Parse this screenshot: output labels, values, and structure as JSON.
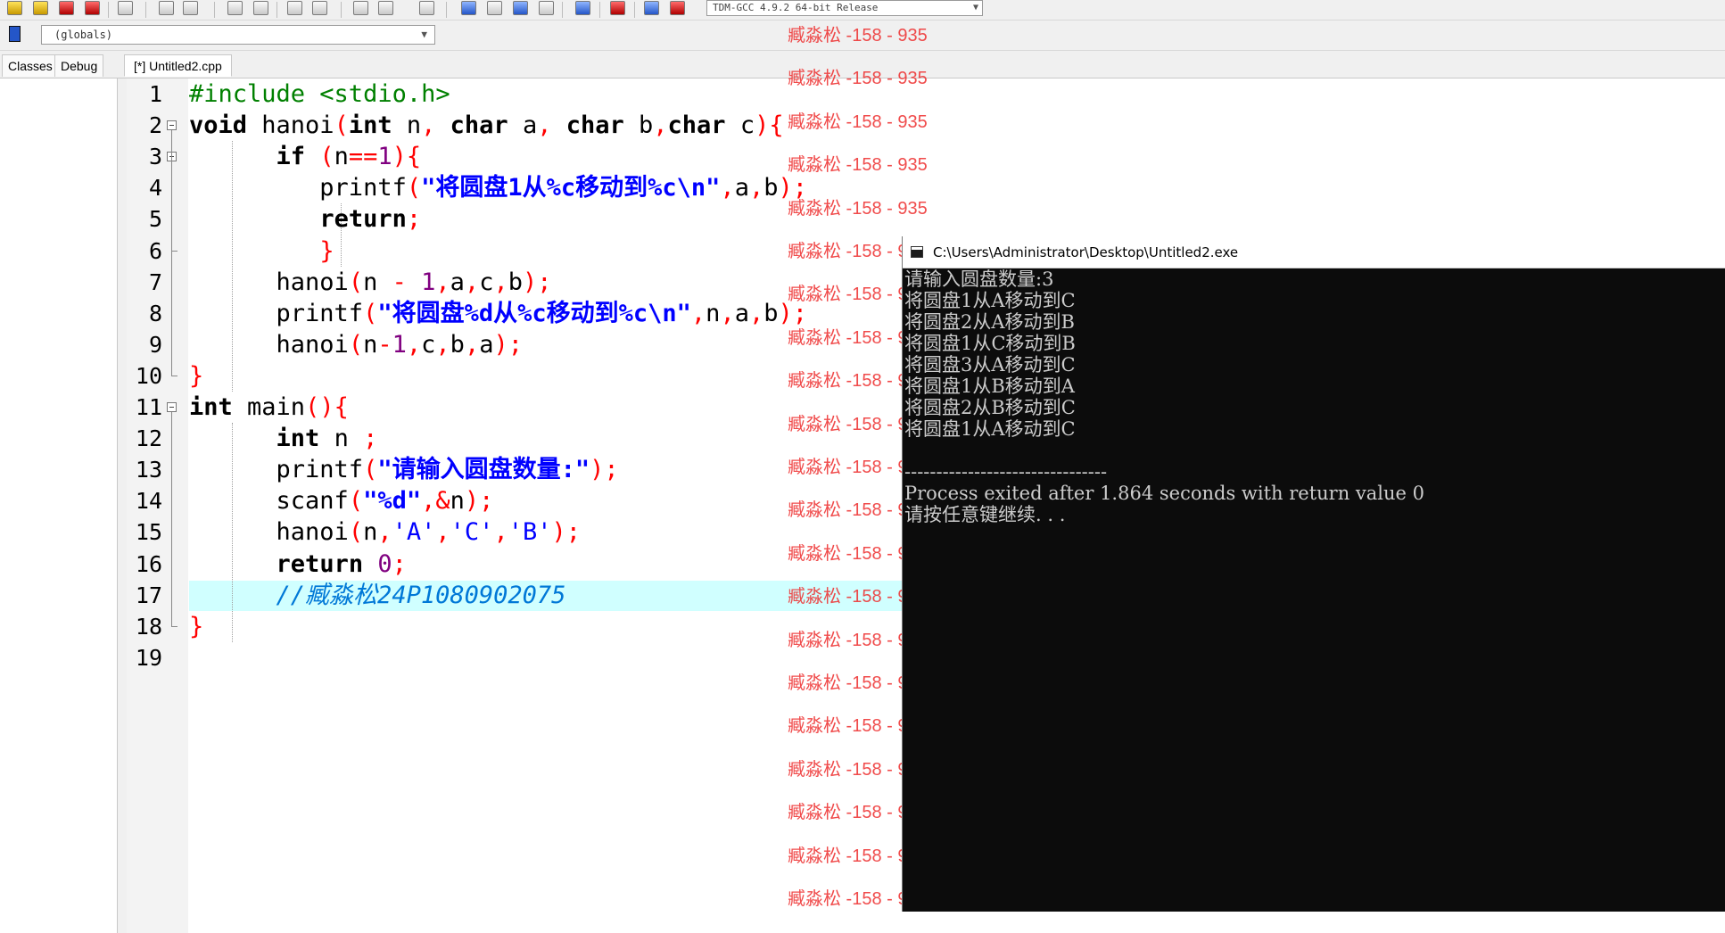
{
  "toolbar": {
    "compiler_profile": "TDM-GCC 4.9.2 64-bit Release",
    "scope": "(globals)"
  },
  "tabs": {
    "left": [
      "Classes",
      "Debug"
    ],
    "file": "[*] Untitled2.cpp"
  },
  "editor": {
    "line_numbers": [
      "1",
      "2",
      "3",
      "4",
      "5",
      "6",
      "7",
      "8",
      "9",
      "10",
      "11",
      "12",
      "13",
      "14",
      "15",
      "16",
      "17",
      "18",
      "19"
    ],
    "lines": [
      [
        {
          "c": "pp",
          "t": "#include <stdio.h>"
        }
      ],
      [
        {
          "c": "kw",
          "t": "void"
        },
        {
          "c": "",
          "t": " hanoi"
        },
        {
          "c": "sym",
          "t": "("
        },
        {
          "c": "kw",
          "t": "int"
        },
        {
          "c": "",
          "t": " n"
        },
        {
          "c": "sym",
          "t": ", "
        },
        {
          "c": "kw",
          "t": "char"
        },
        {
          "c": "",
          "t": " a"
        },
        {
          "c": "sym",
          "t": ", "
        },
        {
          "c": "kw",
          "t": "char"
        },
        {
          "c": "",
          "t": " b"
        },
        {
          "c": "sym",
          "t": ","
        },
        {
          "c": "kw",
          "t": "char"
        },
        {
          "c": "",
          "t": " c"
        },
        {
          "c": "sym",
          "t": "){"
        }
      ],
      [
        {
          "c": "",
          "t": "      "
        },
        {
          "c": "kw",
          "t": "if"
        },
        {
          "c": "",
          "t": " "
        },
        {
          "c": "sym",
          "t": "("
        },
        {
          "c": "",
          "t": "n"
        },
        {
          "c": "sym",
          "t": "=="
        },
        {
          "c": "num",
          "t": "1"
        },
        {
          "c": "sym",
          "t": "){"
        }
      ],
      [
        {
          "c": "",
          "t": "         printf"
        },
        {
          "c": "sym",
          "t": "("
        },
        {
          "c": "str",
          "t": "\"将圆盘1从%c移动到%c\\n\""
        },
        {
          "c": "sym",
          "t": ","
        },
        {
          "c": "",
          "t": "a"
        },
        {
          "c": "sym",
          "t": ","
        },
        {
          "c": "",
          "t": "b"
        },
        {
          "c": "sym",
          "t": ");"
        }
      ],
      [
        {
          "c": "",
          "t": "         "
        },
        {
          "c": "kw",
          "t": "return"
        },
        {
          "c": "sym",
          "t": ";"
        }
      ],
      [
        {
          "c": "",
          "t": "         "
        },
        {
          "c": "sym",
          "t": "}"
        }
      ],
      [
        {
          "c": "",
          "t": "      hanoi"
        },
        {
          "c": "sym",
          "t": "("
        },
        {
          "c": "",
          "t": "n "
        },
        {
          "c": "sym",
          "t": "-"
        },
        {
          "c": "",
          "t": " "
        },
        {
          "c": "num",
          "t": "1"
        },
        {
          "c": "sym",
          "t": ","
        },
        {
          "c": "",
          "t": "a"
        },
        {
          "c": "sym",
          "t": ","
        },
        {
          "c": "",
          "t": "c"
        },
        {
          "c": "sym",
          "t": ","
        },
        {
          "c": "",
          "t": "b"
        },
        {
          "c": "sym",
          "t": ");"
        }
      ],
      [
        {
          "c": "",
          "t": "      printf"
        },
        {
          "c": "sym",
          "t": "("
        },
        {
          "c": "str",
          "t": "\"将圆盘%d从%c移动到%c\\n\""
        },
        {
          "c": "sym",
          "t": ","
        },
        {
          "c": "",
          "t": "n"
        },
        {
          "c": "sym",
          "t": ","
        },
        {
          "c": "",
          "t": "a"
        },
        {
          "c": "sym",
          "t": ","
        },
        {
          "c": "",
          "t": "b"
        },
        {
          "c": "sym",
          "t": ");"
        }
      ],
      [
        {
          "c": "",
          "t": "      hanoi"
        },
        {
          "c": "sym",
          "t": "("
        },
        {
          "c": "",
          "t": "n"
        },
        {
          "c": "sym",
          "t": "-"
        },
        {
          "c": "num",
          "t": "1"
        },
        {
          "c": "sym",
          "t": ","
        },
        {
          "c": "",
          "t": "c"
        },
        {
          "c": "sym",
          "t": ","
        },
        {
          "c": "",
          "t": "b"
        },
        {
          "c": "sym",
          "t": ","
        },
        {
          "c": "",
          "t": "a"
        },
        {
          "c": "sym",
          "t": ");"
        }
      ],
      [
        {
          "c": "sym",
          "t": "}"
        }
      ],
      [
        {
          "c": "kw",
          "t": "int"
        },
        {
          "c": "",
          "t": " main"
        },
        {
          "c": "sym",
          "t": "(){"
        }
      ],
      [
        {
          "c": "",
          "t": "      "
        },
        {
          "c": "kw",
          "t": "int"
        },
        {
          "c": "",
          "t": " n "
        },
        {
          "c": "sym",
          "t": ";"
        }
      ],
      [
        {
          "c": "",
          "t": "      printf"
        },
        {
          "c": "sym",
          "t": "("
        },
        {
          "c": "str",
          "t": "\"请输入圆盘数量:\""
        },
        {
          "c": "sym",
          "t": ");"
        }
      ],
      [
        {
          "c": "",
          "t": "      scanf"
        },
        {
          "c": "sym",
          "t": "("
        },
        {
          "c": "str",
          "t": "\"%d\""
        },
        {
          "c": "sym",
          "t": ",&"
        },
        {
          "c": "",
          "t": "n"
        },
        {
          "c": "sym",
          "t": ");"
        }
      ],
      [
        {
          "c": "",
          "t": "      hanoi"
        },
        {
          "c": "sym",
          "t": "("
        },
        {
          "c": "",
          "t": "n"
        },
        {
          "c": "sym",
          "t": ","
        },
        {
          "c": "chr",
          "t": "'A'"
        },
        {
          "c": "sym",
          "t": ","
        },
        {
          "c": "chr",
          "t": "'C'"
        },
        {
          "c": "sym",
          "t": ","
        },
        {
          "c": "chr",
          "t": "'B'"
        },
        {
          "c": "sym",
          "t": ");"
        }
      ],
      [
        {
          "c": "",
          "t": "      "
        },
        {
          "c": "kw",
          "t": "return"
        },
        {
          "c": "",
          "t": " "
        },
        {
          "c": "num",
          "t": "0"
        },
        {
          "c": "sym",
          "t": ";"
        }
      ],
      [
        {
          "c": "",
          "t": "      "
        },
        {
          "c": "cmt",
          "t": "//臧淼松24P1080902075"
        }
      ],
      [
        {
          "c": "sym",
          "t": "}"
        }
      ],
      []
    ]
  },
  "console": {
    "title": "C:\\Users\\Administrator\\Desktop\\Untitled2.exe",
    "lines": [
      "请输入圆盘数量:3",
      "将圆盘1从A移动到C",
      "将圆盘2从A移动到B",
      "将圆盘1从C移动到B",
      "将圆盘3从A移动到C",
      "将圆盘1从B移动到A",
      "将圆盘2从B移动到C",
      "将圆盘1从A移动到C",
      "",
      "--------------------------------",
      "Process exited after 1.864 seconds with return value 0",
      "请按任意键继续. . ."
    ]
  },
  "watermark": {
    "text": "臧淼松 -158 - 935",
    "color": "#ee3333"
  }
}
